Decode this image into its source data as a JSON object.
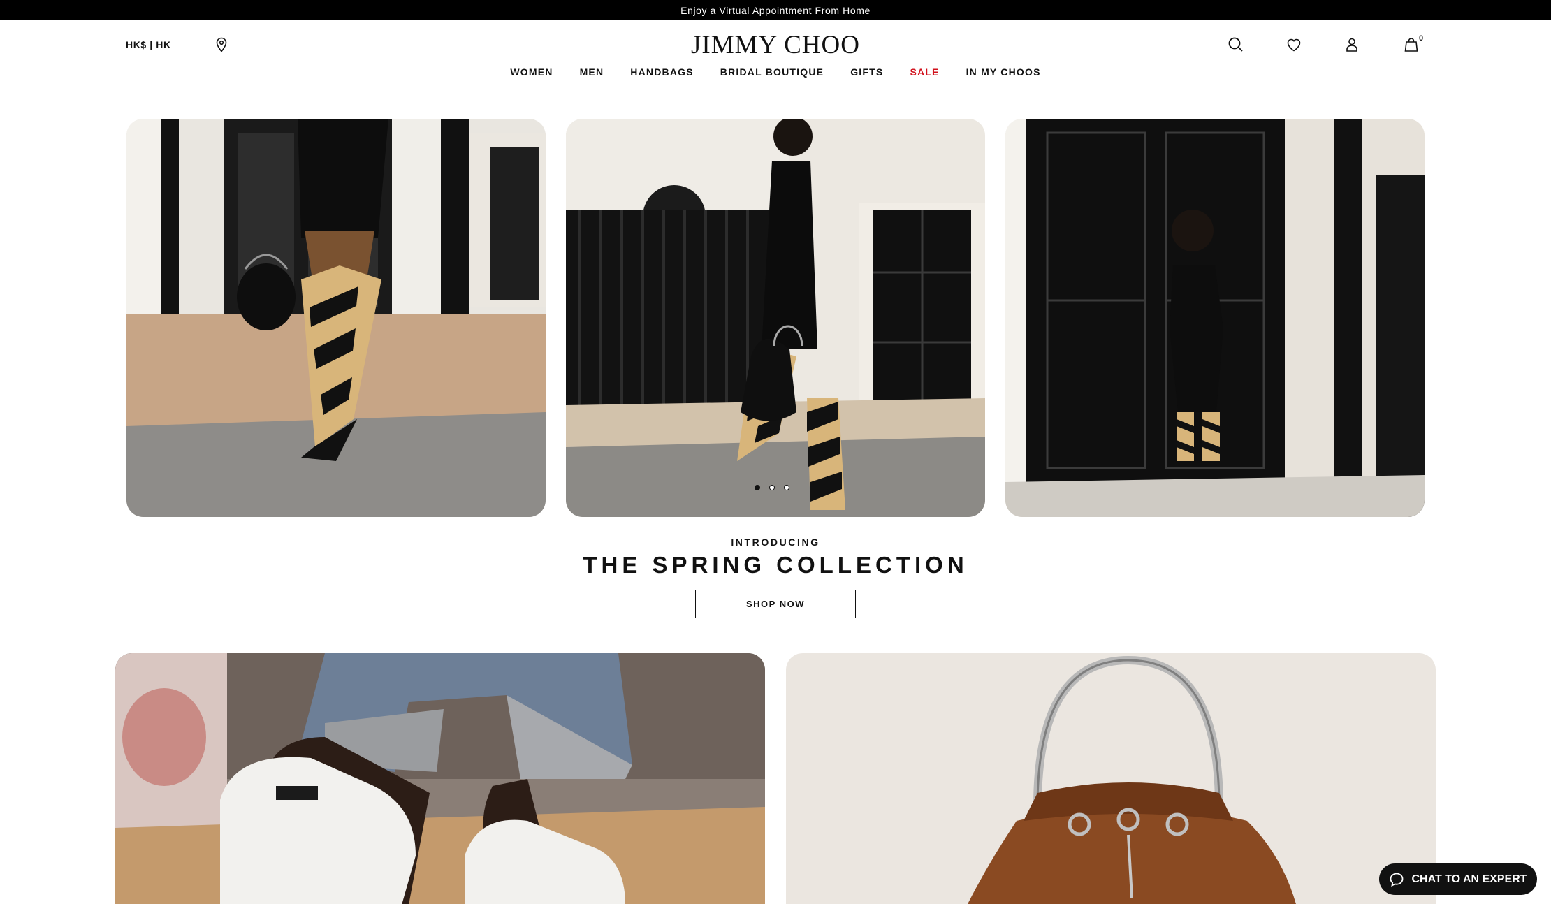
{
  "announcement": "Enjoy a Virtual Appointment From Home",
  "header": {
    "locale": "HK$ | HK",
    "logo": "JIMMY CHOO",
    "bag_count": "0"
  },
  "nav": {
    "items": [
      "WOMEN",
      "MEN",
      "HANDBAGS",
      "BRIDAL BOUTIQUE",
      "GIFTS",
      "SALE",
      "IN MY CHOOS"
    ]
  },
  "hero": {
    "slides": 3,
    "active_slide": 1,
    "kicker": "INTRODUCING",
    "title": "THE SPRING COLLECTION",
    "cta": "SHOP NOW"
  },
  "chat": {
    "label": "CHAT TO AN EXPERT"
  },
  "colors": {
    "sale": "#d1101b",
    "boot_tan": "#d8b57a",
    "suede_brown": "#8a4a22"
  }
}
